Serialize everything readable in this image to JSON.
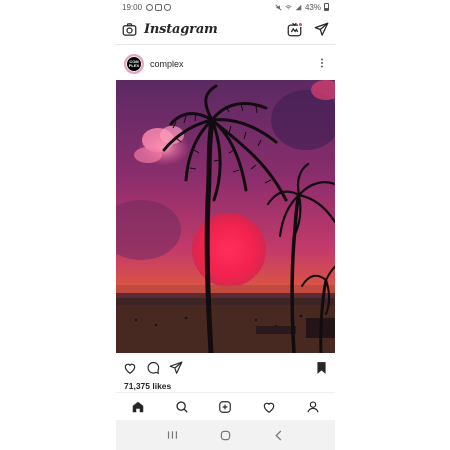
{
  "status_bar": {
    "time": "19:00",
    "battery": "43%"
  },
  "app": {
    "name": "Instagram"
  },
  "post": {
    "username": "complex",
    "avatar_text": "COM\nPLEX",
    "likes": "71,375 likes",
    "saved": true
  },
  "icons": {
    "camera": "camera-icon",
    "igtv": "igtv-icon",
    "direct": "paper-plane-icon",
    "more": "more-vertical-icon",
    "like": "heart-icon",
    "comment": "comment-icon",
    "share": "paper-plane-icon",
    "save": "bookmark-icon",
    "home": "home-icon",
    "search": "search-icon",
    "add": "add-post-icon",
    "activity": "heart-icon",
    "profile": "profile-icon",
    "recents": "recents-icon",
    "android_home": "home-circle-icon",
    "back": "back-icon"
  },
  "colors": {
    "notification": "#ed4956",
    "text": "#262626",
    "avatar_ring": "#e8a3c4"
  }
}
